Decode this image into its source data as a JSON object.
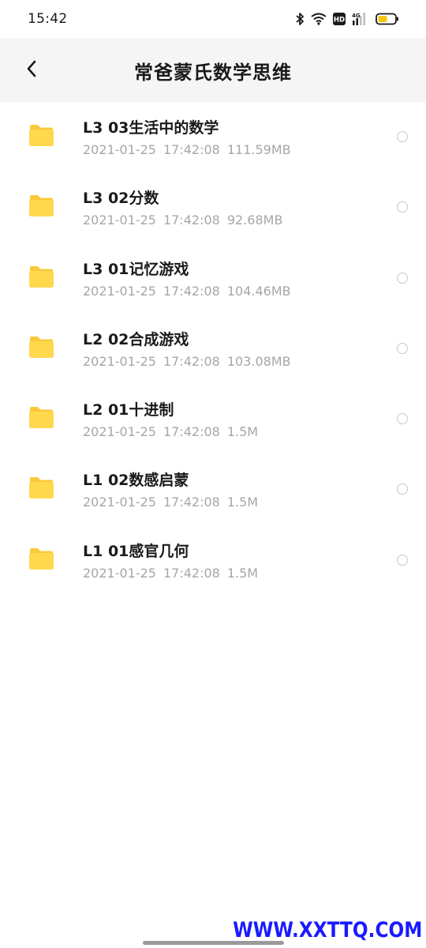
{
  "status_bar": {
    "time": "15:42",
    "icons": [
      "bluetooth-icon",
      "wifi-icon",
      "hd-icon",
      "4g-signal-icon",
      "battery-icon"
    ],
    "hd_label": "HD",
    "network_label": "4G",
    "battery_color": "#f5c518"
  },
  "header": {
    "title": "常爸蒙氏数学思维",
    "back_icon": "chevron-left-icon"
  },
  "files": [
    {
      "name": "L3 03生活中的数学",
      "date": "2021-01-25",
      "time": "17:42:08",
      "size": "111.59MB"
    },
    {
      "name": "L3 02分数",
      "date": "2021-01-25",
      "time": "17:42:08",
      "size": "92.68MB"
    },
    {
      "name": "L3 01记忆游戏",
      "date": "2021-01-25",
      "time": "17:42:08",
      "size": "104.46MB"
    },
    {
      "name": "L2 02合成游戏",
      "date": "2021-01-25",
      "time": "17:42:08",
      "size": "103.08MB"
    },
    {
      "name": "L2 01十进制",
      "date": "2021-01-25",
      "time": "17:42:08",
      "size": "1.5M"
    },
    {
      "name": "L1 02数感启蒙",
      "date": "2021-01-25",
      "time": "17:42:08",
      "size": "1.5M"
    },
    {
      "name": "L1 01感官几何",
      "date": "2021-01-25",
      "time": "17:42:08",
      "size": "1.5M"
    }
  ],
  "colors": {
    "folder": "#ffd84d",
    "folder_tab": "#f8c93a",
    "nav_background": "#f5f5f5",
    "meta_text": "#a6a6a6",
    "watermark": "#1a1aff"
  },
  "watermark": "WWW.XXTTQ.COM"
}
